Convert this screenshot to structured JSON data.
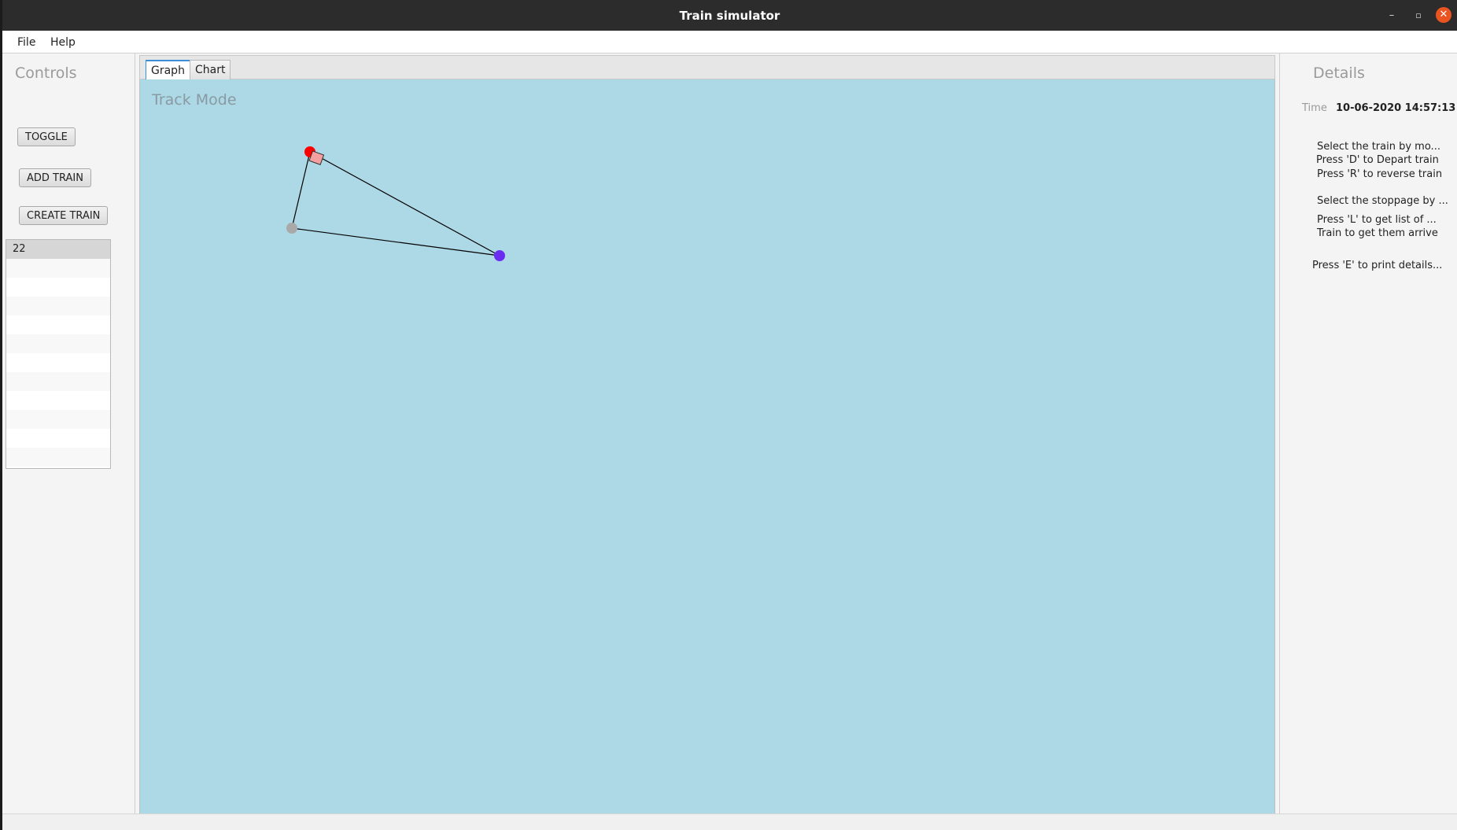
{
  "window": {
    "title": "Train simulator",
    "minimize_label": "–",
    "maximize_label": "▫",
    "close_label": "✕"
  },
  "menu": {
    "file": "File",
    "help": "Help"
  },
  "controls": {
    "title": "Controls",
    "toggle_label": "TOGGLE",
    "add_train_label": "ADD TRAIN",
    "create_train_label": "CREATE TRAIN",
    "train_list": [
      "22",
      "",
      "",
      "",
      "",
      "",
      "",
      "",
      "",
      "",
      "",
      ""
    ],
    "selected_index": 0
  },
  "tabs": {
    "graph": "Graph",
    "chart": "Chart",
    "active": "graph"
  },
  "canvas": {
    "mode_label": "Track Mode",
    "background": "#add8e6",
    "colors": {
      "station_red": "#ff0000",
      "station_grey": "#a9a9a9",
      "station_blue": "#6a2cf0",
      "train_fill": "#f4a0a0",
      "track": "#000000"
    }
  },
  "details": {
    "title": "Details",
    "time_label": "Time",
    "time_value": "10-06-2020 14:57:13",
    "hints": [
      "Select the train by mo...",
      "Press 'D' to Depart train",
      "Press 'R' to reverse train",
      "Select the stoppage by ...",
      "Press 'L' to get list of ...",
      "Train to get them arrive",
      "Press 'E' to print details..."
    ]
  }
}
